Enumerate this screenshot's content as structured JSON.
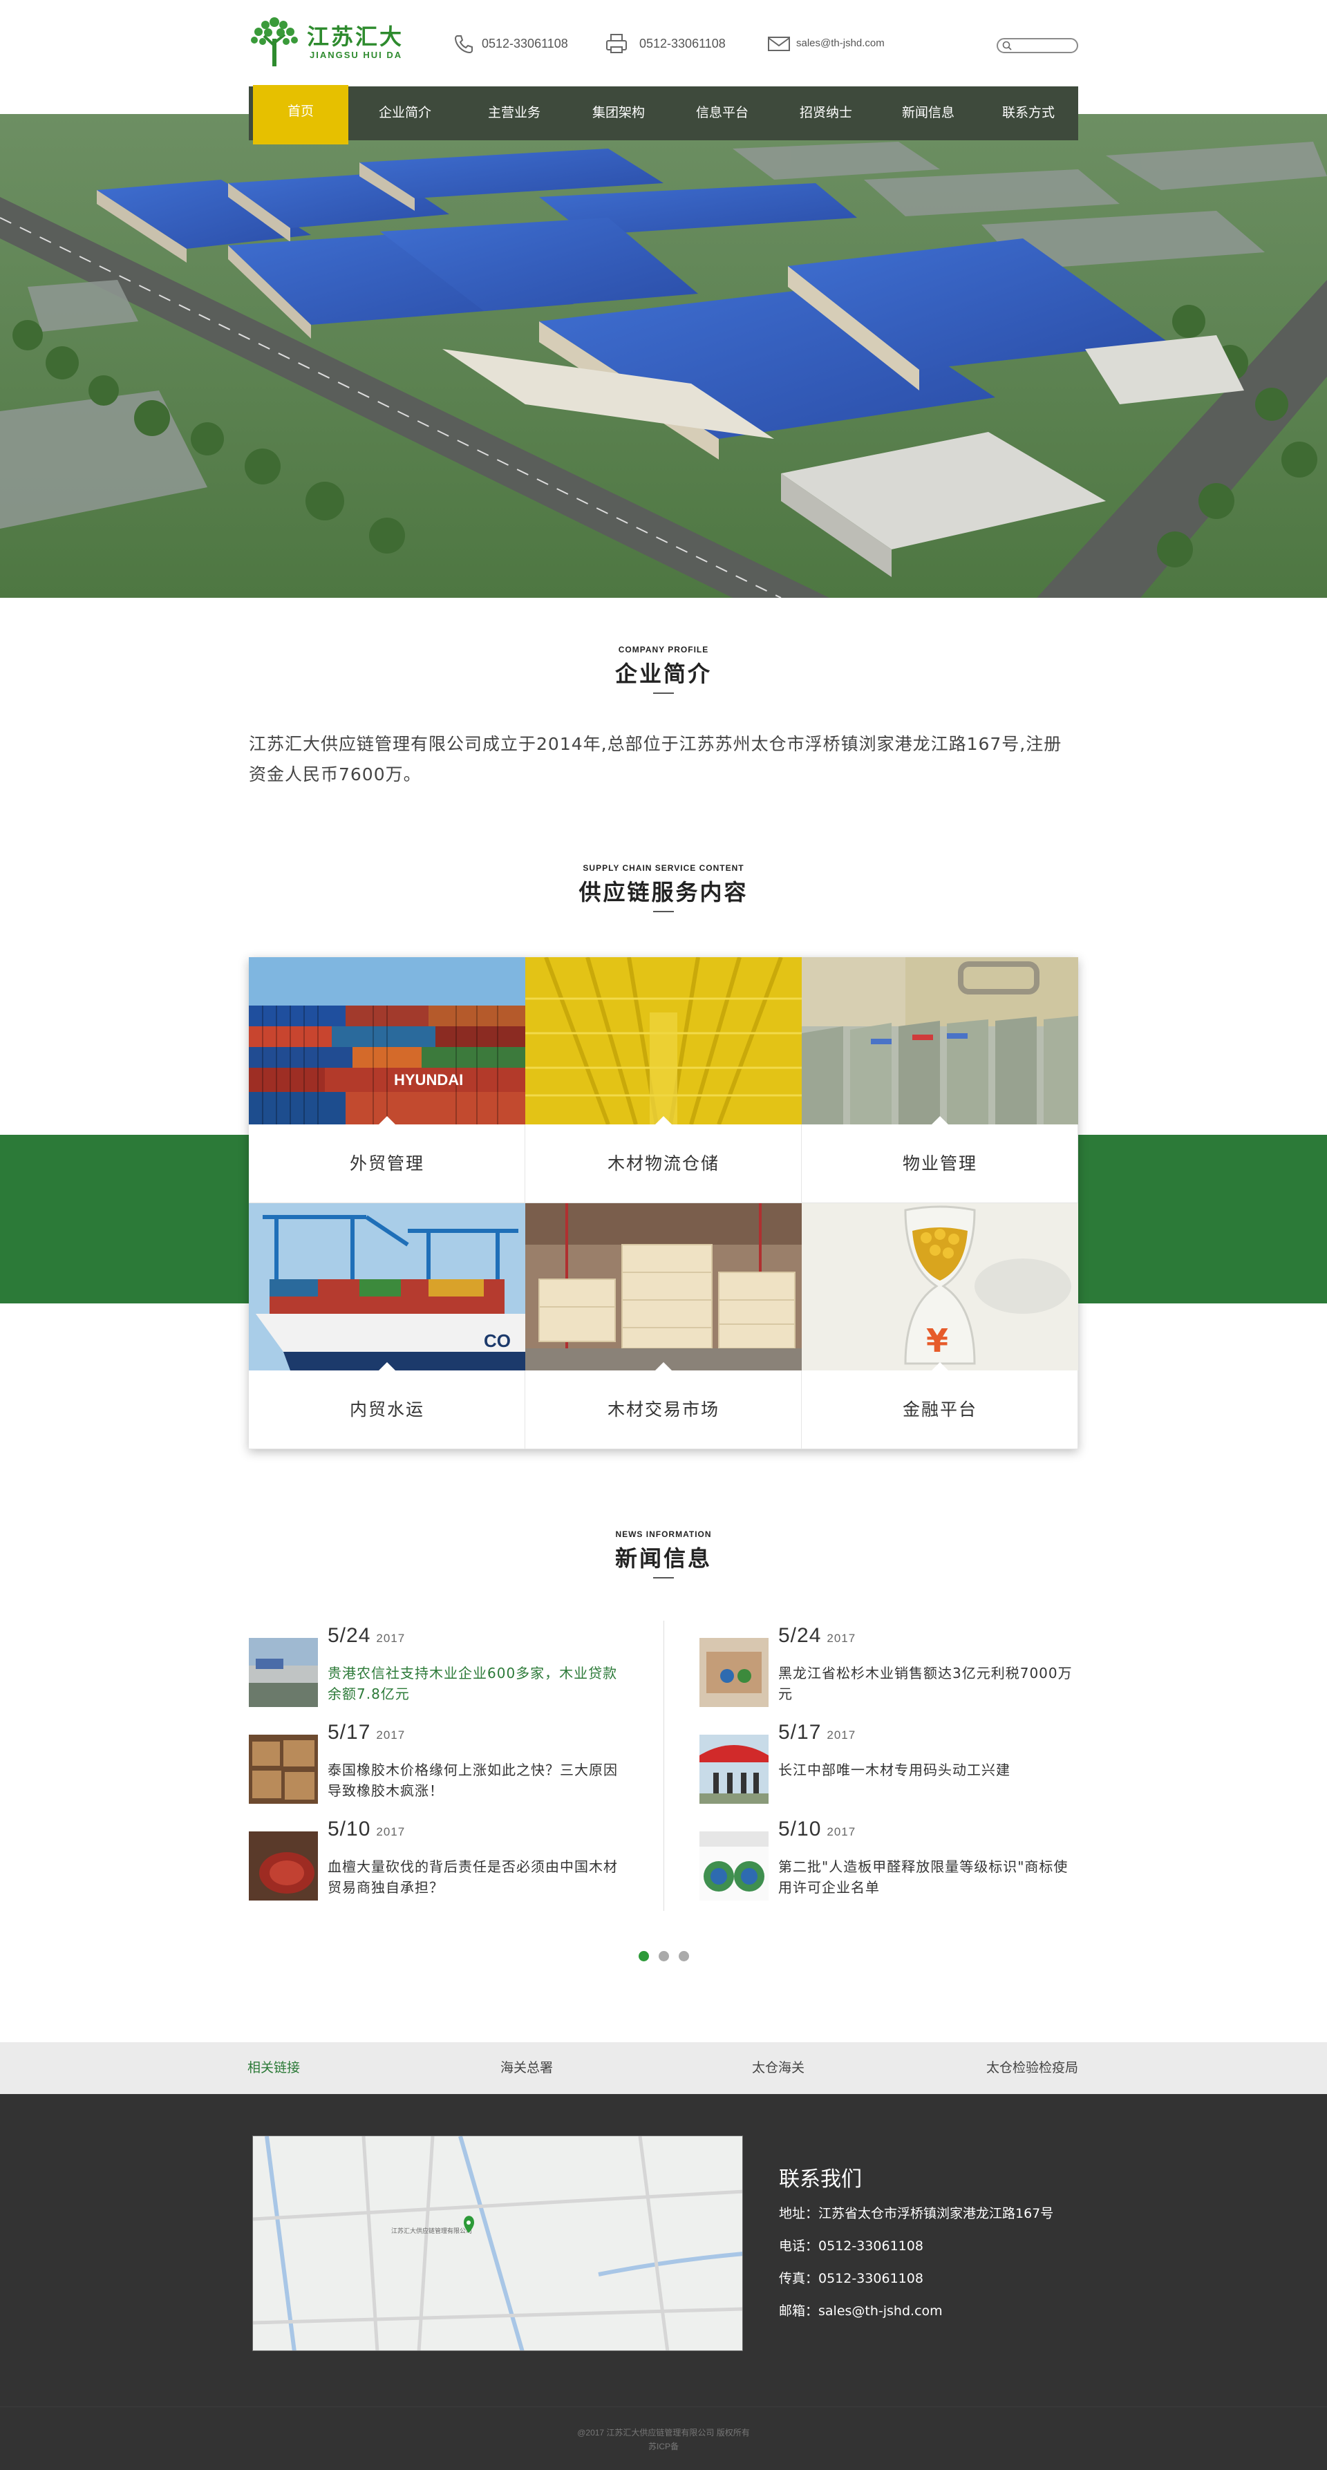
{
  "header": {
    "logo_cn": "江苏汇大",
    "logo_en": "JIANGSU  HUI  DA",
    "phone": "0512-33061108",
    "fax": "0512-33061108",
    "email": "sales@th-jshd.com",
    "search_placeholder": ""
  },
  "nav": [
    "首页",
    "企业简介",
    "主营业务",
    "集团架构",
    "信息平台",
    "招贤纳士",
    "新闻信息",
    "联系方式"
  ],
  "profile": {
    "en": "COMPANY PROFILE",
    "cn": "企业简介",
    "text": "江苏汇大供应链管理有限公司成立于2014年,总部位于江苏苏州太仓市浮桥镇浏家港龙江路167号,注册资金人民币7600万。"
  },
  "services": {
    "en": "SUPPLY CHAIN SERVICE CONTENT",
    "cn": "供应链服务内容",
    "items": [
      "外贸管理",
      "木材物流仓储",
      "物业管理",
      "内贸水运",
      "木材交易市场",
      "金融平台"
    ]
  },
  "news": {
    "en": "NEWS INFORMATION",
    "cn": "新闻信息",
    "left": [
      {
        "date": "5/24",
        "year": "2017",
        "title": "贵港农信社支持木业企业600多家，木业贷款余额7.8亿元"
      },
      {
        "date": "5/17",
        "year": "2017",
        "title": "泰国橡胶木价格缘何上涨如此之快？三大原因导致橡胶木疯涨！"
      },
      {
        "date": "5/10",
        "year": "2017",
        "title": "血檀大量砍伐的背后责任是否必须由中国木材贸易商独自承担？"
      }
    ],
    "right": [
      {
        "date": "5/24",
        "year": "2017",
        "title": "黑龙江省松杉木业销售额达3亿元利税7000万元"
      },
      {
        "date": "5/17",
        "year": "2017",
        "title": "长江中部唯一木材专用码头动工兴建"
      },
      {
        "date": "5/10",
        "year": "2017",
        "title": "第二批\"人造板甲醛释放限量等级标识\"商标使用许可企业名单"
      }
    ]
  },
  "links": {
    "head": "相关链接",
    "items": [
      "海关总署",
      "太仓海关",
      "太仓检验检疫局"
    ]
  },
  "footer": {
    "title": "联系我们",
    "address": "地址：江苏省太仓市浮桥镇浏家港龙江路167号",
    "phone": "电话：0512-33061108",
    "fax": "传真：0512-33061108",
    "email": "邮箱：sales@th-jshd.com",
    "map_label": "江苏汇大供应链管理有限公司",
    "copyright_1": "@2017 江苏汇大供应链管理有限公司  版权所有",
    "copyright_2": "苏ICP备"
  },
  "colors": {
    "brand_green": "#2c7a38",
    "nav_bg": "#3e4a3c",
    "nav_active": "#e6c000",
    "footer_bg": "#333333"
  }
}
